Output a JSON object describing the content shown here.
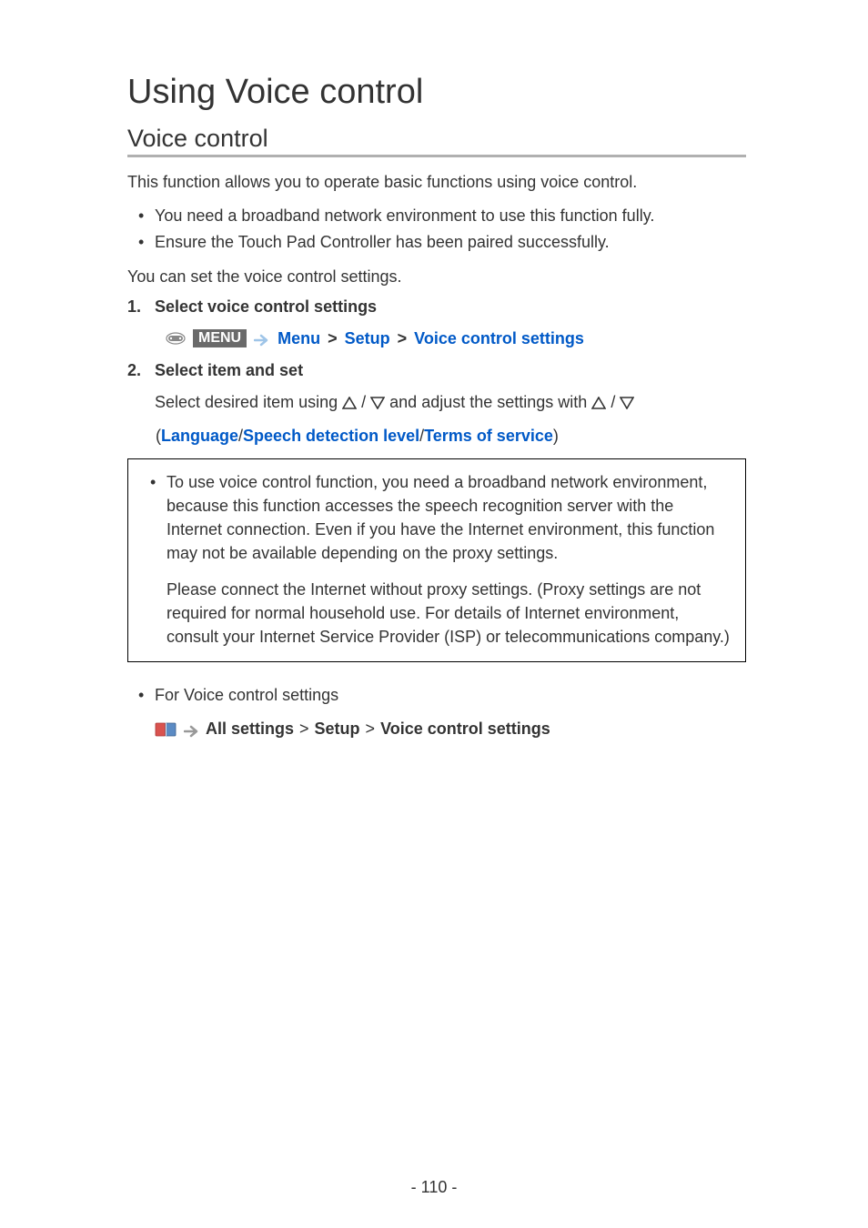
{
  "title": "Using Voice control",
  "subtitle": "Voice control",
  "intro": "This function allows you to operate basic functions using voice control.",
  "bullets": [
    "You need a broadband network environment to use this function fully.",
    "Ensure the Touch Pad Controller has been paired successfully."
  ],
  "intro2": "You can set the voice control settings.",
  "steps": {
    "s1": {
      "title": "Select voice control settings",
      "badge": "MENU",
      "path": {
        "menu": "Menu",
        "setup": "Setup",
        "vcs": "Voice control settings",
        "gt": ">"
      }
    },
    "s2": {
      "title": "Select item and set",
      "body_pre": "Select desired item using ",
      "body_mid": " and adjust the settings with ",
      "slash": " / ",
      "options": {
        "open": "(",
        "close": ")",
        "a": "Language",
        "b": "Speech detection level",
        "c": "Terms of service",
        "sep": "/"
      }
    }
  },
  "note": {
    "b1": "To use voice control function, you need a broadband network environment, because this function accesses the speech recognition server with the Internet connection. Even if you have the Internet environment, this function may not be available depending on the proxy settings.",
    "p1": "Please connect the Internet without proxy settings. (Proxy settings are not required for normal household use. For details of Internet environment, consult your Internet Service Provider (ISP) or telecommunications company.)"
  },
  "footer_bullet": "For Voice control settings",
  "ref": {
    "all": "All settings",
    "setup": "Setup",
    "vcs": "Voice control settings",
    "gt": " > "
  },
  "page_num": "- 110 -"
}
